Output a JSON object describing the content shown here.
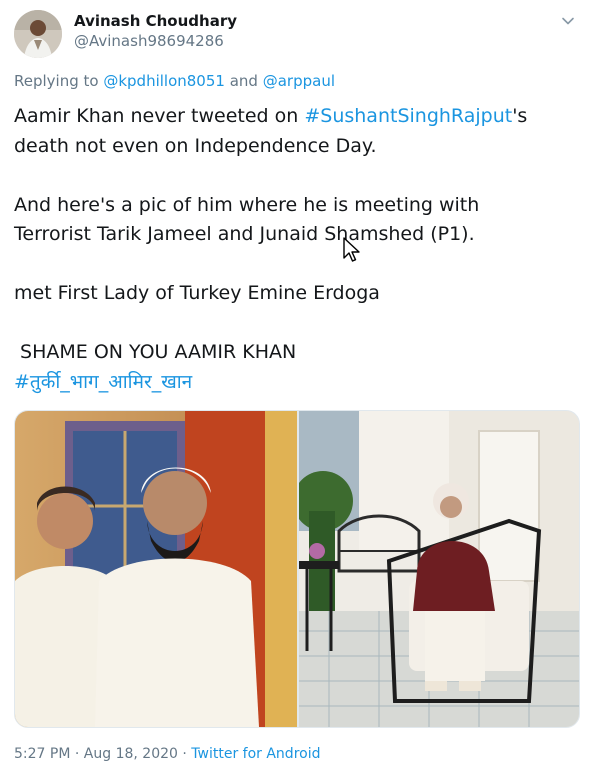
{
  "author": {
    "display_name": "Avinash Choudhary",
    "handle": "@Avinash98694286"
  },
  "reply": {
    "prefix": "Replying to ",
    "mention_1": "@kpdhillon8051",
    "joiner": " and ",
    "mention_2": "@arppaul"
  },
  "tweet": {
    "line1_pre": "Aamir Khan never tweeted on ",
    "line1_hashtag": "#SushantSinghRajput",
    "line1_post": "'s",
    "line2": "death not even on Independence Day.",
    "line3": "And here's a pic of him where he is meeting with",
    "line4": "Terrorist Tarik Jameel and Junaid Shamshed (P1).",
    "line5": "met First Lady of Turkey Emine Erdoga",
    "line6": " SHAME ON YOU AAMIR KHAN",
    "line7_hashtag": "#तुर्की_भाग_आमिर_खान"
  },
  "footer": {
    "time": "5:27 PM",
    "sep1": " · ",
    "date": "Aug 18, 2020",
    "sep2": " · ",
    "source": "Twitter for Android"
  },
  "icons": {
    "caret": "chevron-down-icon",
    "cursor": "mouse-pointer-icon"
  },
  "colors": {
    "link": "#1b95e0",
    "secondary_text": "#657786",
    "primary_text": "#14171a"
  }
}
